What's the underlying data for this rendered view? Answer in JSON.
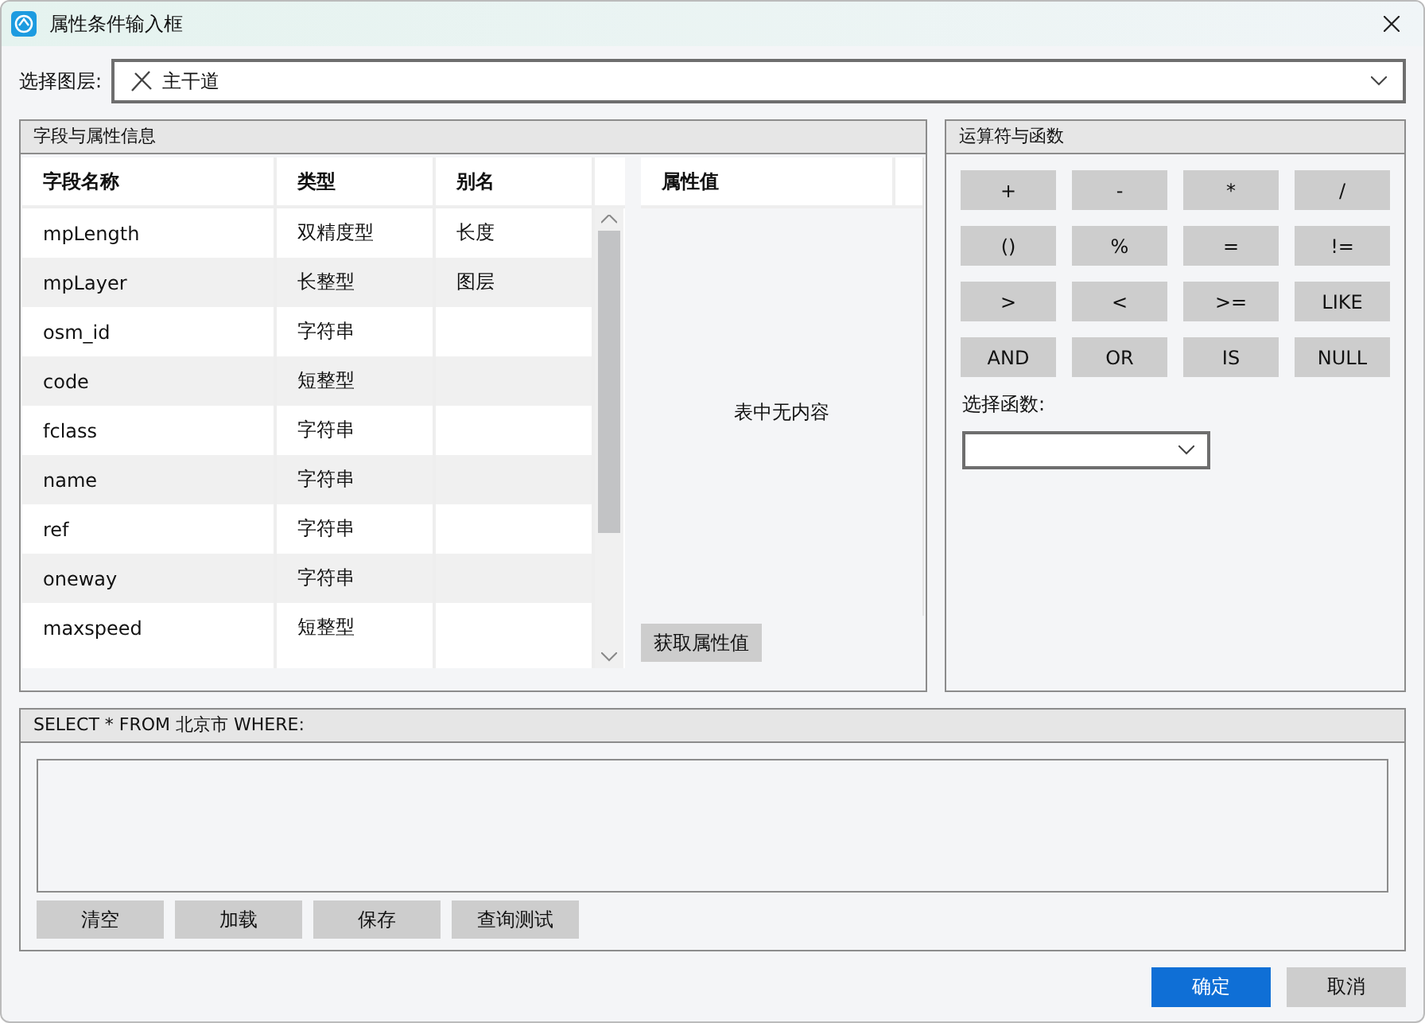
{
  "window": {
    "title": "属性条件输入框"
  },
  "layer": {
    "label": "选择图层:",
    "value": "主干道"
  },
  "fields_panel": {
    "title": "字段与属性信息",
    "columns": [
      "字段名称",
      "类型",
      "别名"
    ],
    "rows": [
      {
        "name": "mpLength",
        "type": "双精度型",
        "alias": "长度"
      },
      {
        "name": "mpLayer",
        "type": "长整型",
        "alias": "图层"
      },
      {
        "name": "osm_id",
        "type": "字符串",
        "alias": ""
      },
      {
        "name": "code",
        "type": "短整型",
        "alias": ""
      },
      {
        "name": "fclass",
        "type": "字符串",
        "alias": ""
      },
      {
        "name": "name",
        "type": "字符串",
        "alias": ""
      },
      {
        "name": "ref",
        "type": "字符串",
        "alias": ""
      },
      {
        "name": "oneway",
        "type": "字符串",
        "alias": ""
      },
      {
        "name": "maxspeed",
        "type": "短整型",
        "alias": ""
      }
    ],
    "values_header": "属性值",
    "empty_text": "表中无内容",
    "get_values_button": "获取属性值"
  },
  "operators_panel": {
    "title": "运算符与函数",
    "operators": [
      "+",
      "-",
      "*",
      "/",
      "()",
      "%",
      "=",
      "!=",
      ">",
      "<",
      ">=",
      "LIKE",
      "AND",
      "OR",
      "IS",
      "NULL"
    ],
    "function_label": "选择函数:"
  },
  "query": {
    "title": "SELECT * FROM 北京市 WHERE:",
    "buttons": [
      "清空",
      "加载",
      "保存",
      "查询测试"
    ]
  },
  "buttons": [
    {
      "label": "确定",
      "primary": true
    },
    {
      "label": "取消",
      "primary": false
    }
  ]
}
